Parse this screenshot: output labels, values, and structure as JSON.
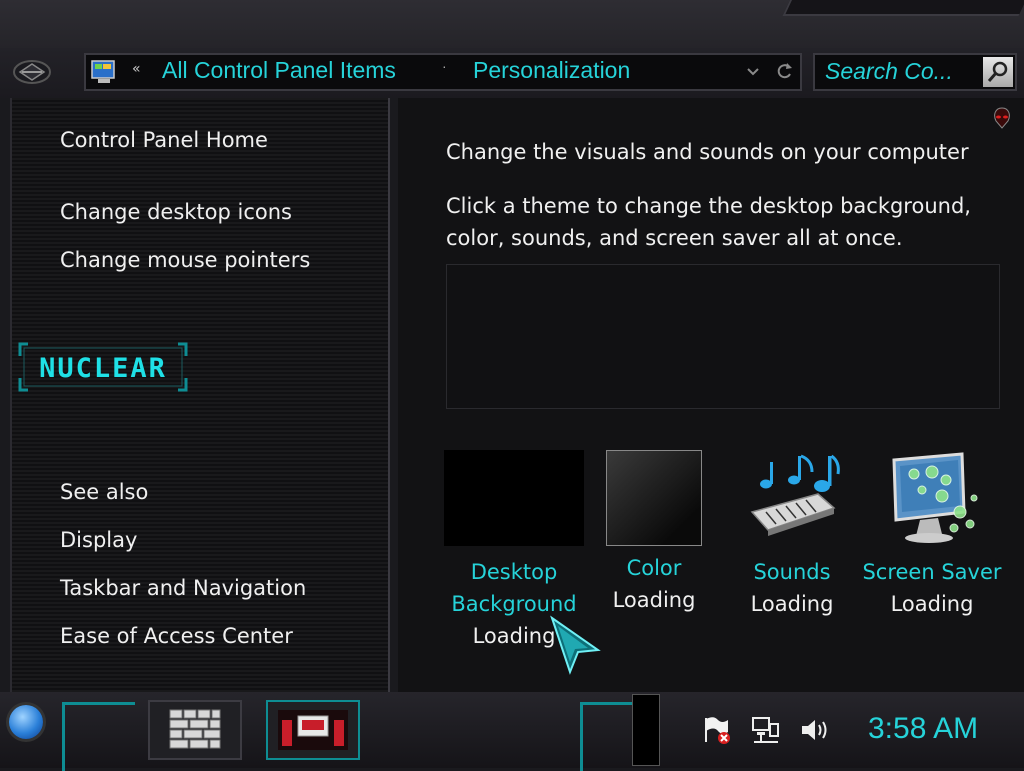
{
  "window": {
    "breadcrumb_prefix": "«",
    "breadcrumbs": [
      "All Control Panel Items",
      "Personalization"
    ],
    "breadcrumb_separator": "·",
    "search_placeholder": "Search Co..."
  },
  "sidebar": {
    "home_link": "Control Panel Home",
    "links": [
      "Change desktop icons",
      "Change mouse pointers"
    ],
    "logo_text": "NUCLEAR",
    "see_also_heading": "See also",
    "see_also_links": [
      "Display",
      "Taskbar and Navigation",
      "Ease of Access Center"
    ]
  },
  "main": {
    "title": "Change the visuals and sounds on your computer",
    "description": "Click a theme to change the desktop background, color, sounds, and screen saver all at once.",
    "tiles": [
      {
        "label": "Desktop Background",
        "status": "Loading",
        "icon": "desktop-background-icon"
      },
      {
        "label": "Color",
        "status": "Loading",
        "icon": "color-swatch-icon"
      },
      {
        "label": "Sounds",
        "status": "Loading",
        "icon": "sounds-icon"
      },
      {
        "label": "Screen Saver",
        "status": "Loading",
        "icon": "screen-saver-icon"
      }
    ]
  },
  "taskbar": {
    "clock": "3:58 AM",
    "tray_icons": [
      "action-center-flag-icon",
      "network-icon",
      "volume-icon"
    ]
  },
  "colors": {
    "accent": "#26d3d9",
    "background": "#121214",
    "text": "#f0f0f0"
  }
}
